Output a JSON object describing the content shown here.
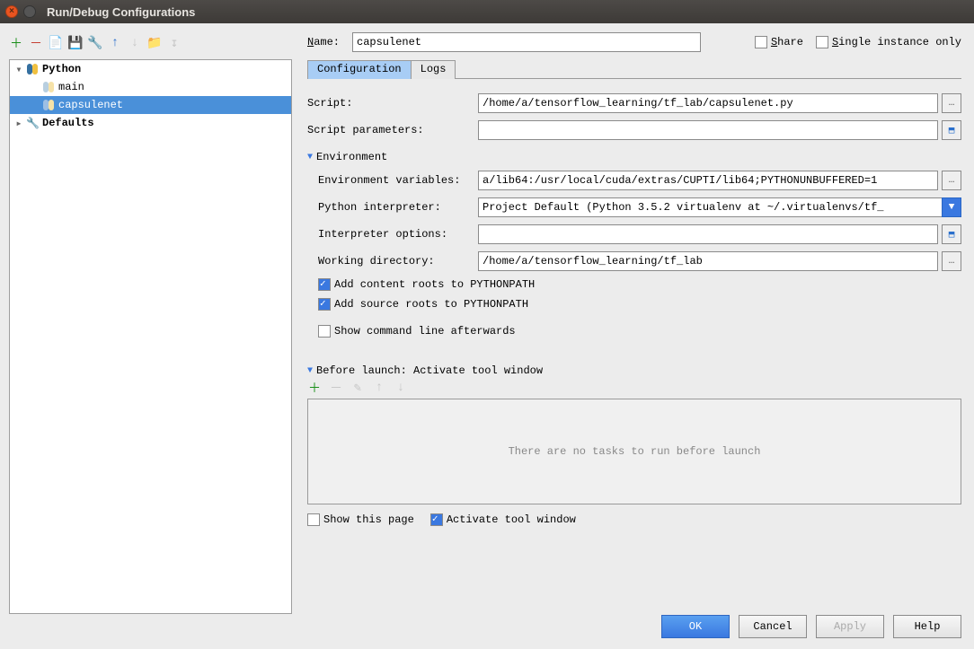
{
  "window": {
    "title": "Run/Debug Configurations"
  },
  "topright": {
    "name_label": "Name:",
    "name_value": "capsulenet",
    "share_label": "Share",
    "single_label": "Single instance only"
  },
  "tree": {
    "python_label": "Python",
    "main_label": "main",
    "capsulenet_label": "capsulenet",
    "defaults_label": "Defaults"
  },
  "tabs": {
    "config": "Configuration",
    "logs": "Logs"
  },
  "form": {
    "script_label": "Script:",
    "script_value": "/home/a/tensorflow_learning/tf_lab/capsulenet.py",
    "scriptparams_label": "Script parameters:",
    "scriptparams_value": "",
    "env_header": "Environment",
    "envvars_label": "Environment variables:",
    "envvars_value": "a/lib64:/usr/local/cuda/extras/CUPTI/lib64;PYTHONUNBUFFERED=1",
    "pyinterp_label": "Python interpreter:",
    "pyinterp_value": "Project Default (Python 3.5.2 virtualenv at ~/.virtualenvs/tf_",
    "interpopts_label": "Interpreter options:",
    "interpopts_value": "",
    "workdir_label": "Working directory:",
    "workdir_value": "/home/a/tensorflow_learning/tf_lab",
    "add_content_label": "Add content roots to PYTHONPATH",
    "add_source_label": "Add source roots to PYTHONPATH",
    "show_cmd_label": "Show command line afterwards"
  },
  "before": {
    "header": "Before launch: Activate tool window",
    "empty_text": "There are no tasks to run before launch",
    "show_page_label": "Show this page",
    "activate_label": "Activate tool window"
  },
  "footer": {
    "ok": "OK",
    "cancel": "Cancel",
    "apply": "Apply",
    "help": "Help"
  }
}
